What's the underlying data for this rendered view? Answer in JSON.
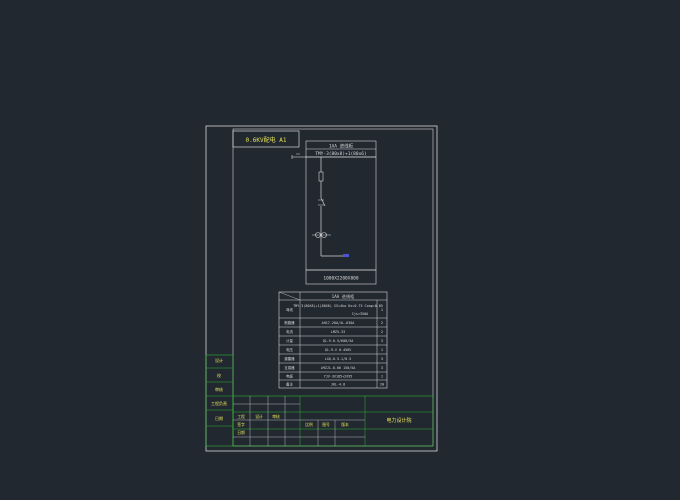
{
  "drawing": {
    "title_block_label": "0.6KV配电 A1",
    "panel_header_1": "1AA 进线柜",
    "panel_header_2": "TMY-3(80x8)+1(80x6)",
    "panel_dims": "1000X2200X800",
    "table_header_col": "1AA  进线柜",
    "rows": [
      {
        "label": "母线",
        "value": "TMY-3(80X8)+1(80X6)  SS=4kw  Kx=0.75 Cosφ=0.85",
        "value2": "Ijs=350A",
        "qty": "1"
      },
      {
        "label": "断路器",
        "value": "AH17-20A/4L-630A",
        "qty": "2"
      },
      {
        "label": "电流",
        "value": "LMZ5-33",
        "qty": "2"
      },
      {
        "label": "计量",
        "value": "Q1-9-0.5/600/5A",
        "qty": "3"
      },
      {
        "label": "电压",
        "value": "Q1-9-V 0-450V",
        "qty": "1"
      },
      {
        "label": "避雷器",
        "value": "LXQ-0.5-1/0.5",
        "qty": "3"
      },
      {
        "label": "互感器",
        "value": "LMZJ1-0.66 150/5A",
        "qty": "3"
      },
      {
        "label": "电缆",
        "value": "YJV-3X185+2X95",
        "qty": "1"
      },
      {
        "label": "备注",
        "value": "JKL-4.8",
        "qty": "20"
      }
    ],
    "side_labels": [
      "设计",
      "校",
      "审核",
      "工程负责",
      "日期"
    ],
    "company_label": "电力设计院",
    "tb_small": [
      "工程",
      "设计",
      "审核",
      "签字",
      "日期",
      "比例",
      "图号",
      "版本"
    ]
  },
  "colors": {
    "background": "#212830",
    "line_white": "#d8d8d8",
    "line_green": "#2fb52f",
    "text_yellow": "#e7e25a",
    "accent_blue": "#4a52d8"
  }
}
